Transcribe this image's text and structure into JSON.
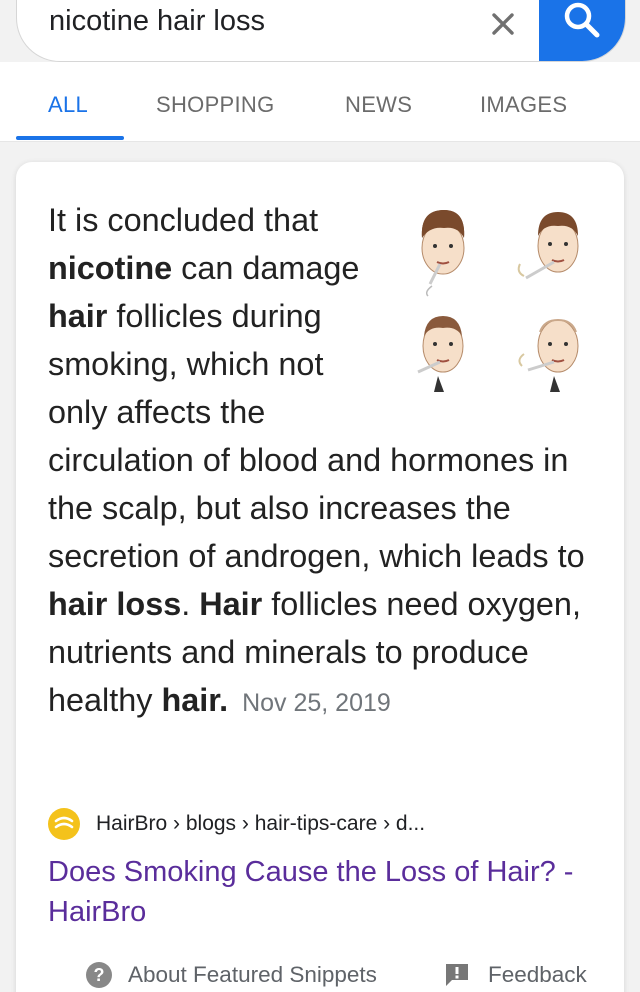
{
  "search": {
    "query": "nicotine hair loss"
  },
  "tabs": [
    {
      "label": "ALL",
      "active": true
    },
    {
      "label": "SHOPPING",
      "active": false
    },
    {
      "label": "NEWS",
      "active": false
    },
    {
      "label": "IMAGES",
      "active": false
    }
  ],
  "snippet": {
    "parts": [
      "It is concluded that ",
      "nicotine",
      " can damage ",
      "hair",
      " follicles during smoking, which not only affects the circulation of blood and hormones in the scalp, but also increases the secretion of androgen, which leads to ",
      "hair loss",
      ". ",
      "Hair",
      " follicles need oxygen, nutrients and minerals to produce healthy ",
      "hair",
      "."
    ],
    "date": "Nov 25, 2019",
    "image_icon": "smoking-hair-loss-illustration"
  },
  "source": {
    "breadcrumb": "HairBro › blogs › hair-tips-care › d...",
    "title": "Does Smoking Cause the Loss of Hair? - HairBro",
    "favicon_icon": "hairbro-logo-icon"
  },
  "footer": {
    "about_label": "About Featured Snippets",
    "feedback_label": "Feedback"
  },
  "colors": {
    "accent": "#1a73e8",
    "visited_link": "#5a2d9b",
    "favicon": "#f4c21b"
  }
}
